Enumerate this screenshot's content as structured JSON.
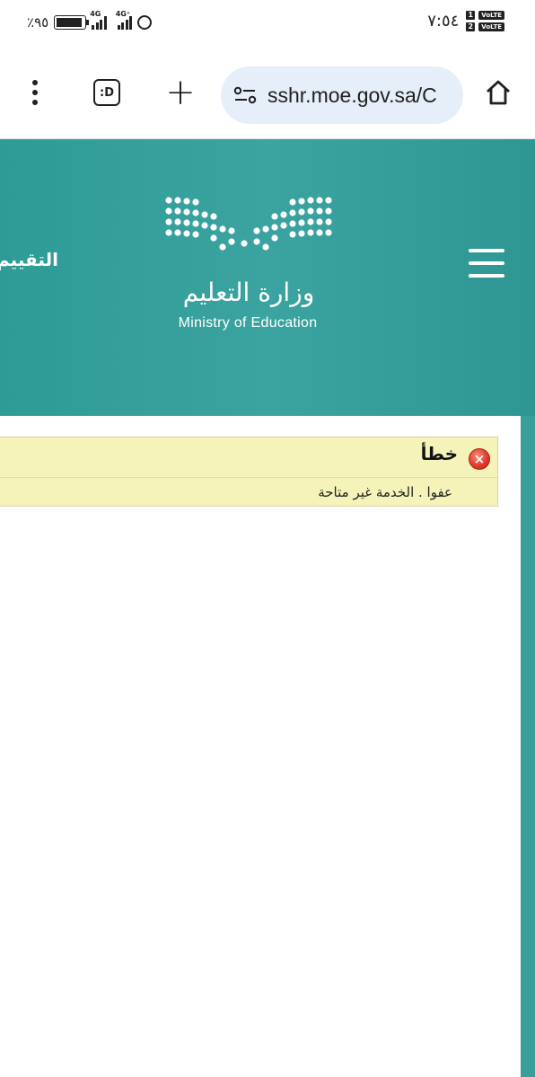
{
  "status_bar": {
    "battery_percent": "٪٩٥",
    "network_1": "4G",
    "network_2": "4G⁺",
    "time": "٧:٥٤",
    "sim1_label": "1",
    "sim2_label": "2",
    "volte_label": "VoLTE"
  },
  "browser": {
    "url": "sshr.moe.gov.sa/C",
    "tabs_badge": ":D"
  },
  "header": {
    "logo_arabic": "وزارة التعليم",
    "logo_english": "Ministry of Education",
    "nav_item": "التقييم"
  },
  "error": {
    "title": "خطأ",
    "message": "عفوا . الخدمة غير متاحة"
  },
  "colors": {
    "header_teal": "#3ba3a0",
    "error_bg": "#f5f3b9",
    "error_icon": "#e23b2c"
  }
}
